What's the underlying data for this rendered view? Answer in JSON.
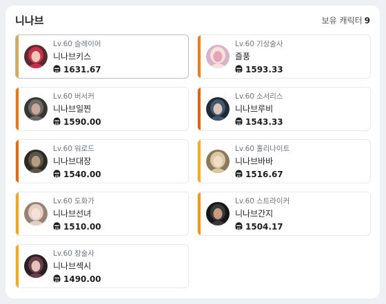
{
  "server": {
    "name": "니나브",
    "count_label": "보유 캐릭터",
    "count": "9"
  },
  "colors": {
    "stripe_gold": "#d1a84a",
    "stripe_orange": "#e8790f",
    "stripe_red_orange": "#e0620f",
    "stripe_yellow": "#f2a81c"
  },
  "characters": [
    {
      "level": "Lv.60",
      "class": "슬레이어",
      "name": "니나브키스",
      "item_level": "1631.67",
      "stripe": "#d3ab55",
      "avatar_colors": [
        "#5a2a2e",
        "#c7304a",
        "#f2c6b8"
      ],
      "icon": "helmet-icon"
    },
    {
      "level": "Lv.60",
      "class": "기상술사",
      "name": "즐풍",
      "item_level": "1593.33",
      "stripe": "#ec7e1a",
      "avatar_colors": [
        "#d8b3c7",
        "#f5e2dc",
        "#e9a3b8"
      ],
      "icon": "helmet-icon"
    },
    {
      "level": "Lv.60",
      "class": "버서커",
      "name": "니나브일찐",
      "item_level": "1590.00",
      "stripe": "#e8760e",
      "avatar_colors": [
        "#3a3634",
        "#6d6a67",
        "#c8a898"
      ],
      "icon": "helmet-icon"
    },
    {
      "level": "Lv.60",
      "class": "소서리스",
      "name": "니나브루비",
      "item_level": "1543.33",
      "stripe": "#e0620f",
      "avatar_colors": [
        "#1f2a36",
        "#44566a",
        "#d9c6bd"
      ],
      "icon": "helmet-icon"
    },
    {
      "level": "Lv.60",
      "class": "워로드",
      "name": "니나브대장",
      "item_level": "1540.00",
      "stripe": "#e46a10",
      "avatar_colors": [
        "#2d2a24",
        "#5b5447",
        "#b89c82"
      ],
      "icon": "helmet-icon"
    },
    {
      "level": "Lv.60",
      "class": "홀리나이트",
      "name": "니나브바바",
      "item_level": "1516.67",
      "stripe": "#f2ad1e",
      "avatar_colors": [
        "#8b7a5a",
        "#d9c8a2",
        "#f1dcc7"
      ],
      "icon": "helmet-icon"
    },
    {
      "level": "Lv.60",
      "class": "도화가",
      "name": "니나브선녀",
      "item_level": "1510.00",
      "stripe": "#f0a51b",
      "avatar_colors": [
        "#9a8073",
        "#e3cfc6",
        "#f3e2da"
      ],
      "icon": "helmet-icon"
    },
    {
      "level": "Lv.60",
      "class": "스트라이커",
      "name": "니나브간지",
      "item_level": "1504.17",
      "stripe": "#ee9a17",
      "avatar_colors": [
        "#161616",
        "#383838",
        "#c99b82"
      ],
      "icon": "helmet-icon"
    },
    {
      "level": "Lv.60",
      "class": "창술사",
      "name": "니나브섹시",
      "item_level": "1490.00",
      "stripe": "#f2ab1d",
      "avatar_colors": [
        "#2a1f22",
        "#6a3c46",
        "#e2c3b9"
      ],
      "icon": "helmet-icon"
    }
  ]
}
